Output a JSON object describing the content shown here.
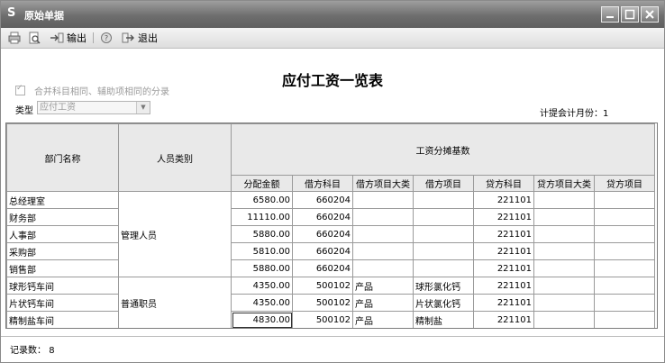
{
  "window": {
    "title": "原始单据"
  },
  "toolbar": {
    "export_label": "输出",
    "exit_label": "退出"
  },
  "report": {
    "title": "应付工资一览表",
    "merge_option": "合并科目相同、辅助项相同的分录",
    "type_label": "类型",
    "type_value": "应付工资",
    "period_label": "计提会计月份：",
    "period_value": "1"
  },
  "table": {
    "headers": {
      "dept": "部门名称",
      "category": "人员类别",
      "group": "工资分摊基数",
      "amount": "分配金额",
      "debit_acct": "借方科目",
      "debit_item_cat": "借方项目大类",
      "debit_item": "借方项目",
      "credit_acct": "贷方科目",
      "credit_item_cat": "贷方项目大类",
      "credit_item": "贷方项目"
    },
    "groups": [
      {
        "category": "管理人员",
        "rows": [
          {
            "dept": "总经理室",
            "amount": "6580.00",
            "debit_acct": "660204",
            "debit_item_cat": "",
            "debit_item": "",
            "credit_acct": "221101"
          },
          {
            "dept": "财务部",
            "amount": "11110.00",
            "debit_acct": "660204",
            "debit_item_cat": "",
            "debit_item": "",
            "credit_acct": "221101"
          },
          {
            "dept": "人事部",
            "amount": "5880.00",
            "debit_acct": "660204",
            "debit_item_cat": "",
            "debit_item": "",
            "credit_acct": "221101"
          },
          {
            "dept": "采购部",
            "amount": "5810.00",
            "debit_acct": "660204",
            "debit_item_cat": "",
            "debit_item": "",
            "credit_acct": "221101"
          },
          {
            "dept": "销售部",
            "amount": "5880.00",
            "debit_acct": "660204",
            "debit_item_cat": "",
            "debit_item": "",
            "credit_acct": "221101"
          }
        ]
      },
      {
        "category": "普通职员",
        "rows": [
          {
            "dept": "球形钙车间",
            "amount": "4350.00",
            "debit_acct": "500102",
            "debit_item_cat": "产品",
            "debit_item": "球形氯化钙",
            "credit_acct": "221101"
          },
          {
            "dept": "片状钙车间",
            "amount": "4350.00",
            "debit_acct": "500102",
            "debit_item_cat": "产品",
            "debit_item": "片状氯化钙",
            "credit_acct": "221101"
          },
          {
            "dept": "精制盐车间",
            "amount": "4830.00",
            "debit_acct": "500102",
            "debit_item_cat": "产品",
            "debit_item": "精制盐",
            "credit_acct": "221101"
          }
        ]
      }
    ]
  },
  "status": {
    "record_label": "记录数：",
    "record_count": "8"
  },
  "icons": [
    "print-icon",
    "preview-icon",
    "export-icon",
    "help-icon",
    "exit-icon",
    "minimize-icon",
    "maximize-icon",
    "close-icon",
    "app-logo-icon",
    "checkmark-icon",
    "chevron-down-icon"
  ]
}
